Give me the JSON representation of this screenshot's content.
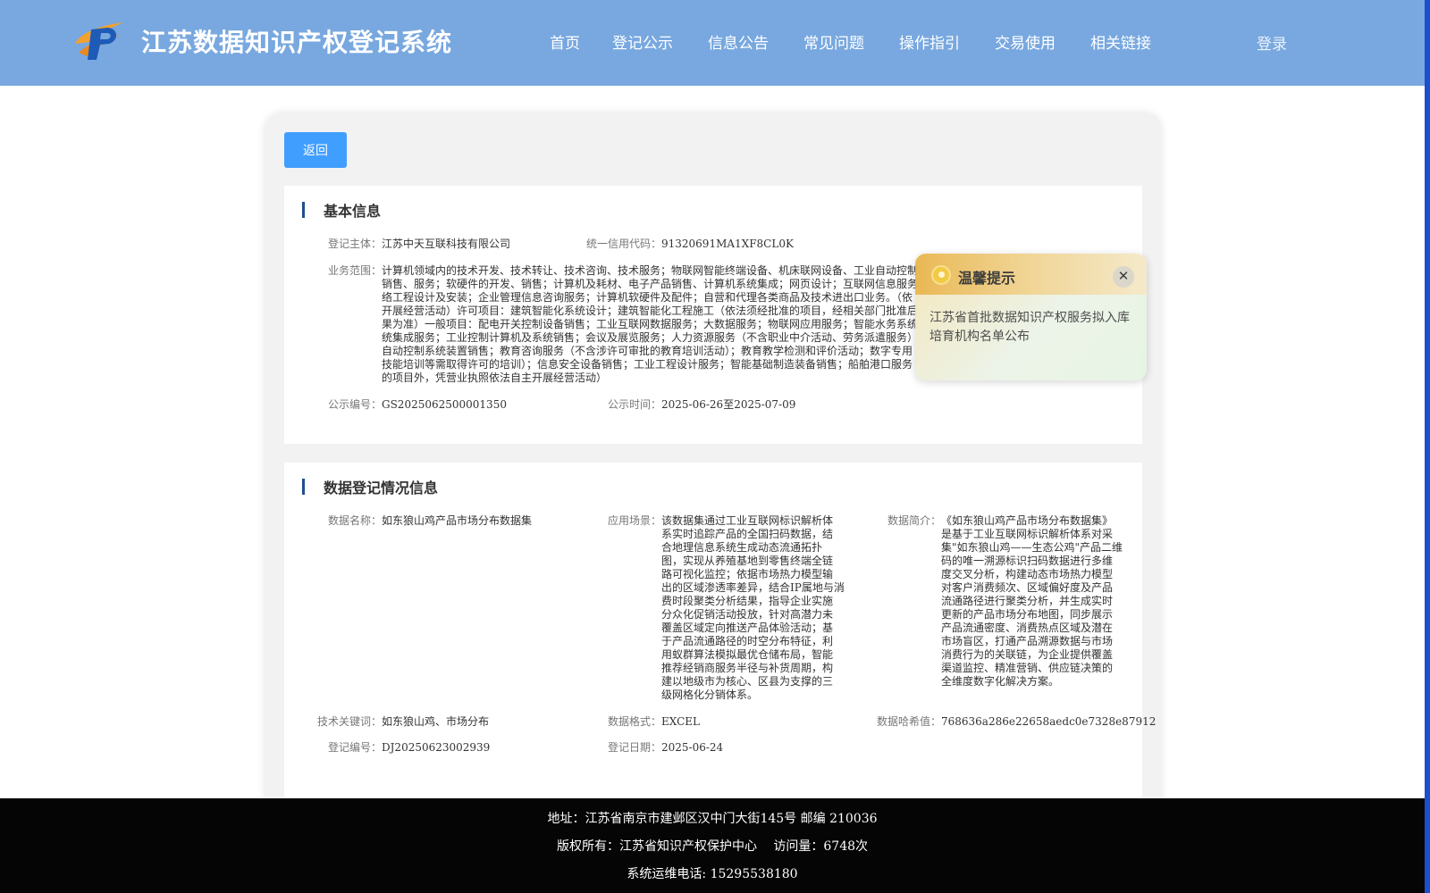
{
  "header": {
    "site_title": "江苏数据知识产权登记系统",
    "logo": "logo-icon",
    "nav": [
      "首页",
      "登记公示",
      "信息公告",
      "常见问题",
      "操作指引",
      "交易使用",
      "相关链接"
    ],
    "login": "登录"
  },
  "back_button": "返回",
  "basic_info": {
    "title": "基本信息",
    "subject_label": "登记主体：",
    "subject_value": "江苏中天互联科技有限公司",
    "credit_label": "统一信用代码：",
    "credit_value": "91320691MA1XF8CL0K",
    "scope_label": "业务范围：",
    "scope_lines": [
      "计算机领域内的技术开发、技术转让、技术咨询、技术服务；物联网智能终端设备、机床联网设备、工业自动控制",
      "销售、服务；软硬件的开发、销售；计算机及耗材、电子产品销售、计算机系统集成；网页设计；互联网信息服务",
      "络工程设计及安装；企业管理信息咨询服务；计算机软硬件及配件；自营和代理各类商品及技术进出口业务。（依",
      "开展经营活动）许可项目：建筑智能化系统设计；建筑智能化工程施工（依法须经批准的项目，经相关部门批准后",
      "果为准）一般项目：配电开关控制设备销售；工业互联网数据服务；大数据服务；物联网应用服务；智能水务系统",
      "统集成服务；工业控制计算机及系统销售；会议及展览服务；人力资源服务（不含职业中介活动、劳务派遣服务）",
      "自动控制系统装置销售；教育咨询服务（不含涉许可审批的教育培训活动）；教育教学检测和评价活动；数字专用",
      "技能培训等需取得许可的培训）；信息安全设备销售；工业工程设计服务；智能基础制造装备销售；船舶港口服务",
      "的项目外，凭营业执照依法自主开展经营活动）"
    ],
    "pub_no_label": "公示编号：",
    "pub_no_value": "GS2025062500001350",
    "pub_time_label": "公示时间：",
    "pub_time_value": "2025-06-26至2025-07-09"
  },
  "registration_info": {
    "title": "数据登记情况信息",
    "name_label": "数据名称：",
    "name_value": "如东狼山鸡产品市场分布数据集",
    "scene_label": "应用场景：",
    "scene_lines": [
      "该数据集通过工业互联网标识解析体",
      "系实时追踪产品的全国扫码数据，结",
      "合地理信息系统生成动态流通拓扑",
      "图，实现从养殖基地到零售终端全链",
      "路可视化监控；依据市场热力模型输",
      "出的区域渗透率差异，结合IP属地与消",
      "费时段聚类分析结果，指导企业实施",
      "分众化促销活动投放，针对高潜力未",
      "覆盖区域定向推送产品体验活动；基",
      "于产品流通路径的时空分布特征，利",
      "用蚁群算法模拟最优仓储布局，智能",
      "推荐经销商服务半径与补货周期，构",
      "建以地级市为核心、区县为支撑的三",
      "级网格化分销体系。"
    ],
    "intro_label": "数据简介：",
    "intro_lines": [
      "《如东狼山鸡产品市场分布数据集》",
      "是基于工业互联网标识解析体系对采",
      "集\"如东狼山鸡——生态公鸡\"产品二维",
      "码的唯一溯源标识扫码数据进行多维",
      "度交叉分析，构建动态市场热力模型",
      "对客户消费频次、区域偏好度及产品",
      "流通路径进行聚类分析，并生成实时",
      "更新的产品市场分布地图，同步展示",
      "产品流通密度、消费热点区域及潜在",
      "市场盲区，打通产品溯源数据与市场",
      "消费行为的关联链，为企业提供覆盖",
      "渠道监控、精准营销、供应链决策的",
      "全维度数字化解决方案。"
    ],
    "keywords_label": "技术关键词：",
    "keywords_value": "如东狼山鸡、市场分布",
    "format_label": "数据格式：",
    "format_value": "EXCEL",
    "hash_label": "数据哈希值：",
    "hash_value": "768636a286e22658aedc0e7328e87912",
    "reg_no_label": "登记编号：",
    "reg_no_value": "DJ20250623002939",
    "reg_date_label": "登记日期：",
    "reg_date_value": "2025-06-24"
  },
  "popup": {
    "icon": "bulb-icon",
    "title": "温馨提示",
    "close": "✕",
    "body": "江苏省首批数据知识产权服务拟入库培育机构名单公布"
  },
  "footer": {
    "address": "地址：江苏省南京市建邺区汉中门大街145号 邮编 210036",
    "copyright": "版权所有：江苏省知识产权保护中心　 访问量：6748次",
    "phone": "系统运维电话: 15295538180"
  }
}
